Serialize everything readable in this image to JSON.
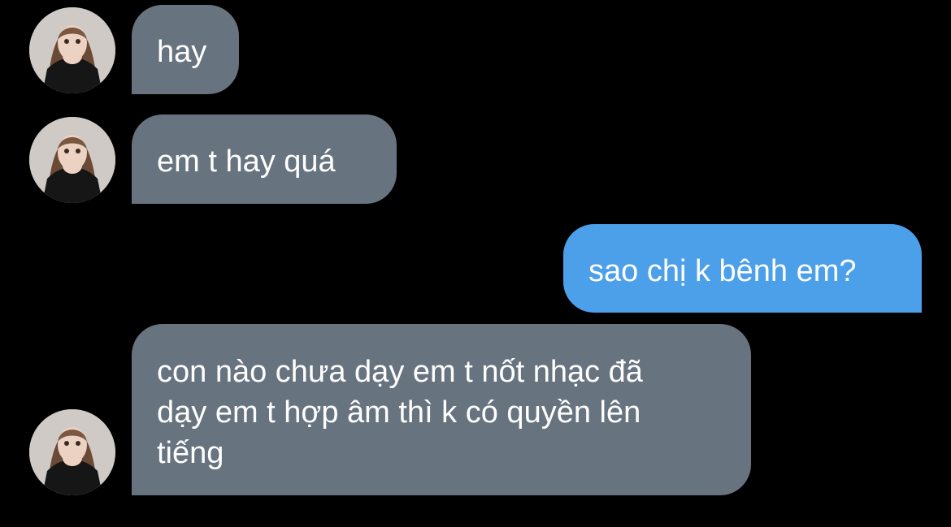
{
  "conversation": {
    "messages": [
      {
        "sender": "contact",
        "text": "hay"
      },
      {
        "sender": "contact",
        "text": "em t hay quá"
      },
      {
        "sender": "me",
        "text": "sao chị k bênh em?"
      },
      {
        "sender": "contact",
        "text": "con nào chưa dạy em t nốt nhạc đã\ndạy em t hợp âm thì k có quyền lên\ntiếng"
      }
    ]
  },
  "colors": {
    "background": "#000000",
    "incoming_bubble": "#67737f",
    "outgoing_bubble": "#4c9fe9",
    "text": "#ffffff"
  },
  "icons": {
    "avatar": "contact-avatar-photo"
  }
}
